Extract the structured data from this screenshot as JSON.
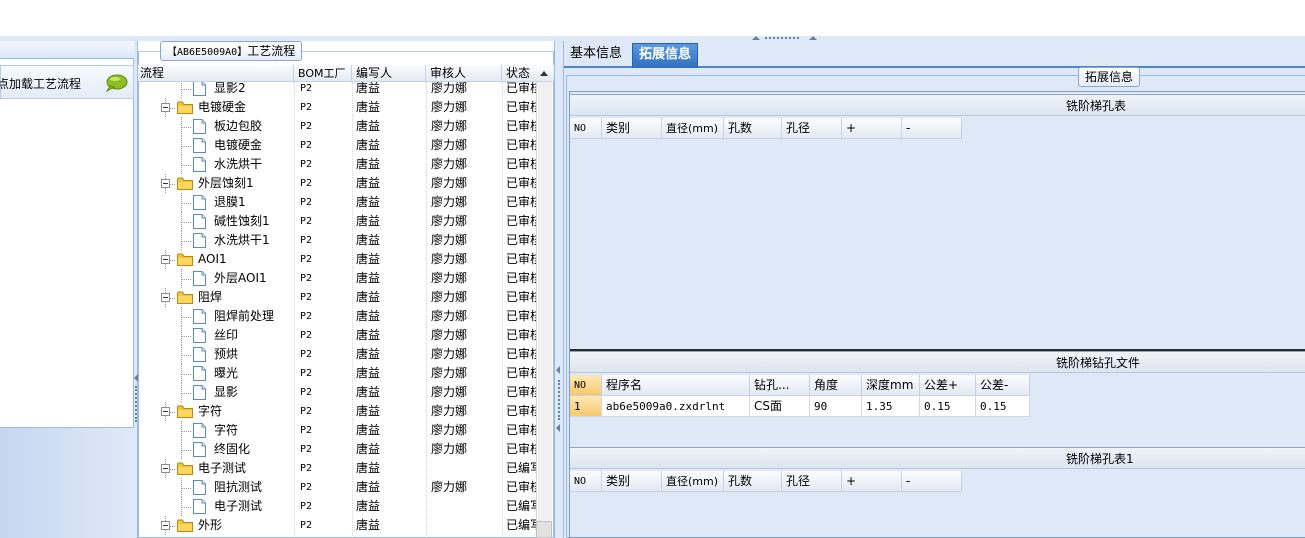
{
  "left_panel": {
    "item_label": "点加载工艺流程",
    "item_icon": "speech-bubble-icon"
  },
  "middle_panel": {
    "legend_code": "【AB6E5009A0】",
    "legend_text": "工艺流程",
    "columns": [
      "流程",
      "BOM工厂",
      "编写人",
      "审核人",
      "状态"
    ],
    "rows": [
      {
        "level": 2,
        "type": "doc",
        "name": "显影2",
        "bom": "P2",
        "author": "唐益",
        "reviewer": "廖力娜",
        "status": "已审核"
      },
      {
        "level": 1,
        "type": "folder",
        "name": "电镀硬金",
        "bom": "P2",
        "author": "唐益",
        "reviewer": "廖力娜",
        "status": "已审核"
      },
      {
        "level": 2,
        "type": "doc",
        "name": "板边包胶",
        "bom": "P2",
        "author": "唐益",
        "reviewer": "廖力娜",
        "status": "已审核"
      },
      {
        "level": 2,
        "type": "doc",
        "name": "电镀硬金",
        "bom": "P2",
        "author": "唐益",
        "reviewer": "廖力娜",
        "status": "已审核"
      },
      {
        "level": 2,
        "type": "doc",
        "name": "水洗烘干",
        "bom": "P2",
        "author": "唐益",
        "reviewer": "廖力娜",
        "status": "已审核"
      },
      {
        "level": 1,
        "type": "folder",
        "name": "外层蚀刻1",
        "bom": "P2",
        "author": "唐益",
        "reviewer": "廖力娜",
        "status": "已审核"
      },
      {
        "level": 2,
        "type": "doc",
        "name": "退膜1",
        "bom": "P2",
        "author": "唐益",
        "reviewer": "廖力娜",
        "status": "已审核"
      },
      {
        "level": 2,
        "type": "doc",
        "name": "碱性蚀刻1",
        "bom": "P2",
        "author": "唐益",
        "reviewer": "廖力娜",
        "status": "已审核"
      },
      {
        "level": 2,
        "type": "doc",
        "name": "水洗烘干1",
        "bom": "P2",
        "author": "唐益",
        "reviewer": "廖力娜",
        "status": "已审核"
      },
      {
        "level": 1,
        "type": "folder",
        "name": "AOI1",
        "bom": "P2",
        "author": "唐益",
        "reviewer": "廖力娜",
        "status": "已审核"
      },
      {
        "level": 2,
        "type": "doc",
        "name": "外层AOI1",
        "bom": "P2",
        "author": "唐益",
        "reviewer": "廖力娜",
        "status": "已审核"
      },
      {
        "level": 1,
        "type": "folder",
        "name": "阻焊",
        "bom": "P2",
        "author": "唐益",
        "reviewer": "廖力娜",
        "status": "已审核"
      },
      {
        "level": 2,
        "type": "doc",
        "name": "阻焊前处理",
        "bom": "P2",
        "author": "唐益",
        "reviewer": "廖力娜",
        "status": "已审核"
      },
      {
        "level": 2,
        "type": "doc",
        "name": "丝印",
        "bom": "P2",
        "author": "唐益",
        "reviewer": "廖力娜",
        "status": "已审核"
      },
      {
        "level": 2,
        "type": "doc",
        "name": "预烘",
        "bom": "P2",
        "author": "唐益",
        "reviewer": "廖力娜",
        "status": "已审核"
      },
      {
        "level": 2,
        "type": "doc",
        "name": "曝光",
        "bom": "P2",
        "author": "唐益",
        "reviewer": "廖力娜",
        "status": "已审核"
      },
      {
        "level": 2,
        "type": "doc",
        "name": "显影",
        "bom": "P2",
        "author": "唐益",
        "reviewer": "廖力娜",
        "status": "已审核"
      },
      {
        "level": 1,
        "type": "folder",
        "name": "字符",
        "bom": "P2",
        "author": "唐益",
        "reviewer": "廖力娜",
        "status": "已审核"
      },
      {
        "level": 2,
        "type": "doc",
        "name": "字符",
        "bom": "P2",
        "author": "唐益",
        "reviewer": "廖力娜",
        "status": "已审核"
      },
      {
        "level": 2,
        "type": "doc",
        "name": "终固化",
        "bom": "P2",
        "author": "唐益",
        "reviewer": "廖力娜",
        "status": "已审核"
      },
      {
        "level": 1,
        "type": "folder",
        "name": "电子测试",
        "bom": "P2",
        "author": "唐益",
        "reviewer": "",
        "status": "已编写"
      },
      {
        "level": 2,
        "type": "doc",
        "name": "阻抗测试",
        "bom": "P2",
        "author": "唐益",
        "reviewer": "廖力娜",
        "status": "已审核"
      },
      {
        "level": 2,
        "type": "doc",
        "name": "电子测试",
        "bom": "P2",
        "author": "唐益",
        "reviewer": "",
        "status": "已编写"
      },
      {
        "level": 1,
        "type": "folder",
        "name": "外形",
        "bom": "P2",
        "author": "唐益",
        "reviewer": "",
        "status": "已编写"
      }
    ]
  },
  "right_panel": {
    "tabs": [
      {
        "label": "基本信息",
        "active": false
      },
      {
        "label": "拓展信息",
        "active": true
      }
    ],
    "legend": "拓展信息",
    "table1": {
      "title": "铣阶梯孔表",
      "columns": [
        "NO",
        "类别",
        "直径(mm)",
        "孔数",
        "孔径",
        "+",
        "-"
      ]
    },
    "table2": {
      "title": "铣阶梯钻孔文件",
      "columns": [
        "NO",
        "程序名",
        "钻孔...",
        "角度",
        "深度mm",
        "公差+",
        "公差-"
      ],
      "rows": [
        [
          "1",
          "ab6e5009a0.zxdrlnt",
          "CS面",
          "90",
          "1.35",
          "0.15",
          "0.15"
        ]
      ]
    },
    "table3": {
      "title": "铣阶梯孔表1",
      "columns": [
        "NO",
        "类别",
        "直径(mm)",
        "孔数",
        "孔径",
        "+",
        "-"
      ]
    }
  },
  "colors": {
    "panel_bg": "#dfe8f6",
    "border": "#99bbe8",
    "active_tab": "#2f6fc0",
    "row_selected": "#f7c96a",
    "folder": "#f2c23a"
  }
}
